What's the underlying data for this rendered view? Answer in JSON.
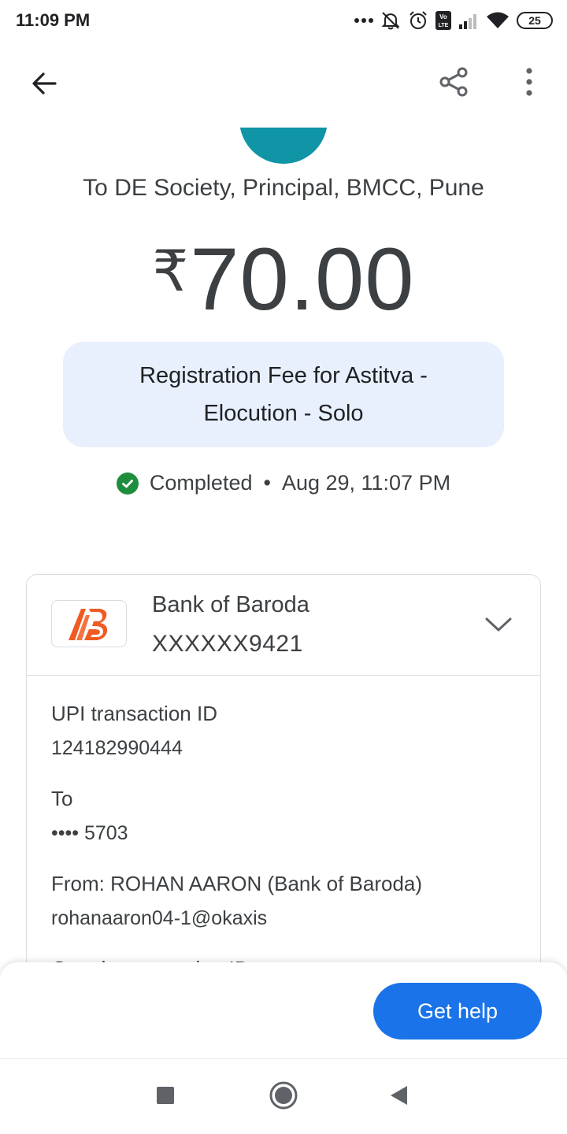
{
  "status_bar": {
    "time": "11:09 PM",
    "network_badge": "Vo LTE",
    "battery_level": "25"
  },
  "app_bar": {
    "back_icon": "arrow-back-icon",
    "share_icon": "share-icon",
    "more_icon": "more-vert-icon"
  },
  "payment": {
    "avatar_color": "#0f95a6",
    "recipient": "To DE Society, Principal, BMCC, Pune",
    "currency_symbol": "₹",
    "amount": "70.00",
    "note": "Registration Fee for Astitva - Elocution - Solo",
    "status": "Completed",
    "separator": "•",
    "datetime": "Aug 29, 11:07 PM",
    "status_color": "#1e8e3e"
  },
  "account": {
    "bank_name": "Bank of Baroda",
    "account_number": "XXXXXX9421",
    "logo_color": "#f15a22"
  },
  "details": [
    {
      "label": "UPI transaction ID",
      "value": "124182990444"
    },
    {
      "label": "To",
      "value": "•••• 5703"
    },
    {
      "label": "From: ROHAN AARON (Bank of Baroda)",
      "value": "rohanaaron04-1@okaxis"
    },
    {
      "label": "Google transaction ID",
      "value": ""
    }
  ],
  "bottom_sheet": {
    "help_label": "Get help",
    "button_color": "#1a73e8"
  },
  "nav_bar": {
    "recents_icon": "square-recents-icon",
    "home_icon": "circle-home-icon",
    "back_icon": "triangle-back-icon"
  }
}
